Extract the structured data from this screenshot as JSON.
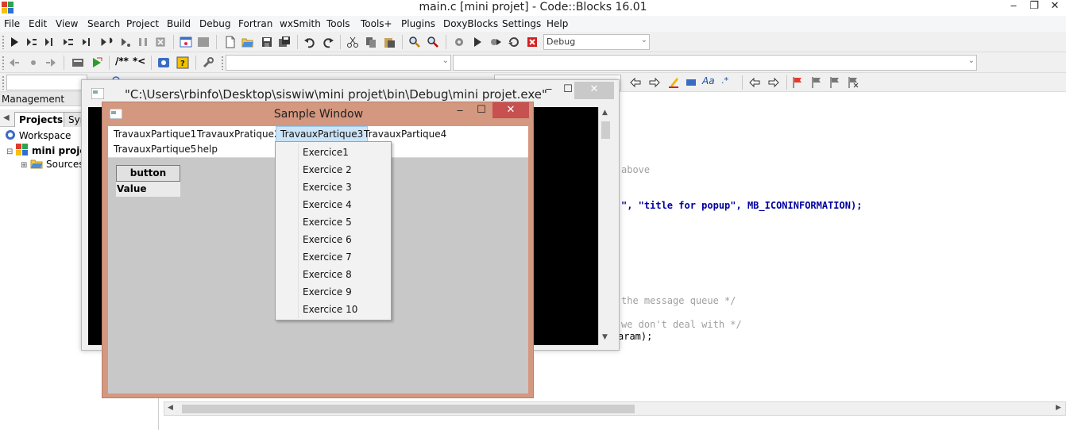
{
  "main_window": {
    "title": "main.c [mini projet] - Code::Blocks 16.01",
    "controls": {
      "minimize": "‒",
      "restore": "❐",
      "close": "✕"
    }
  },
  "menubar": [
    "File",
    "Edit",
    "View",
    "Search",
    "Project",
    "Build",
    "Debug",
    "Fortran",
    "wxSmith",
    "Tools",
    "Tools+",
    "Plugins",
    "DoxyBlocks",
    "Settings",
    "Help"
  ],
  "toolbar": {
    "build_target": "Debug",
    "doxy_comment_block": "/**",
    "doxy_comment_line": "*<"
  },
  "management": {
    "header": "Management",
    "tabs": [
      "Projects",
      "Sym"
    ],
    "tree": {
      "workspace": "Workspace",
      "project": "mini projet",
      "sources": "Sources"
    }
  },
  "editor": {
    "code_lines": [
      {
        "text": "above",
        "kind": "comment"
      },
      {
        "text": "\", \"title for popup\", MB_ICONINFORMATION);",
        "kind": "code"
      },
      {
        "text": "the message queue */",
        "kind": "comment"
      },
      {
        "text": "we don't deal with */",
        "kind": "comment"
      },
      {
        "text": "aram);",
        "kind": "code"
      }
    ]
  },
  "console_window": {
    "title": "\"C:\\Users\\rbinfo\\Desktop\\siswiw\\mini projet\\bin\\Debug\\mini projet.exe\"",
    "controls": {
      "minimize": "‒",
      "maximize": "☐",
      "close": "✕"
    }
  },
  "sample_window": {
    "title": "Sample Window",
    "controls": {
      "minimize": "‒",
      "maximize": "☐",
      "close": "✕"
    },
    "menu_row1": [
      "TravauxPartique1",
      "TravauxPratique2",
      "TravauxPartique3",
      "TravauxPartique4"
    ],
    "menu_row2": [
      "TravauxPartique5",
      "help"
    ],
    "selected_menu": "TravauxPartique3",
    "button_label": "button",
    "value_label": "Value",
    "dropdown_items": [
      "Exercice1",
      "Exercice 2",
      "Exercice 3",
      "Exercice 4",
      "Exercice 5",
      "Exercice 6",
      "Exercice 7",
      "Exercice 8",
      "Exercice 9",
      "Exercice 10"
    ]
  },
  "colors": {
    "sample_frame": "#d4977f",
    "close_red": "#c75050",
    "menu_highlight": "#cce4f7",
    "console_bg": "#000000"
  }
}
